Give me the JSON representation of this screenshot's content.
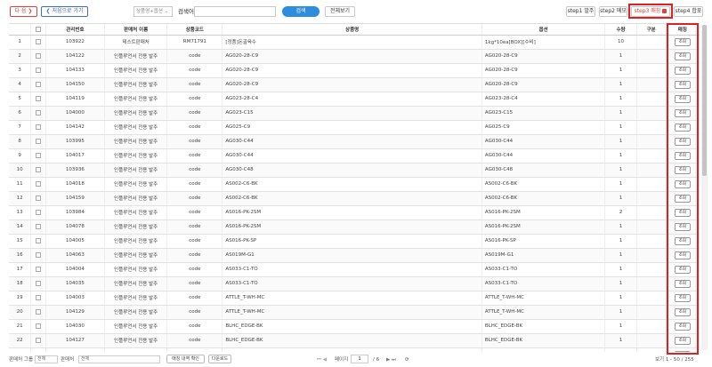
{
  "toolbar": {
    "next_label": "다 음",
    "first_label": "처음으로 가기",
    "filter_select": "상품명+옵션",
    "search_label": "검색어",
    "search_value": "",
    "search_button": "검색",
    "view_all_button": "전체보기",
    "step1": "step1 발주",
    "step2": "step2 메모",
    "step3": "step3 매칭",
    "step4": "step4 합포"
  },
  "columns": [
    "",
    "",
    "관리번호",
    "판매처 이름",
    "상품코드",
    "상품명",
    "옵션",
    "수량",
    "구분",
    "매칭"
  ],
  "lookup_label": "조회",
  "rows": [
    {
      "no": "1",
      "id": "103922",
      "seller": "테스트판매처",
      "code": "RM71791",
      "name": "[정품]돈골육수",
      "option": "1kg*10ea[BOX][수비]",
      "qty": "10"
    },
    {
      "no": "2",
      "id": "104122",
      "seller": "인플루언서 전용 발주",
      "code": "code",
      "name": "AG020-28-C9",
      "option": "AG020-28-C9",
      "qty": "1"
    },
    {
      "no": "3",
      "id": "104133",
      "seller": "인플루언서 전용 발주",
      "code": "code",
      "name": "AG020-28-C9",
      "option": "AG020-28-C9",
      "qty": "1"
    },
    {
      "no": "4",
      "id": "104150",
      "seller": "인플루언서 전용 발주",
      "code": "code",
      "name": "AG020-28-C9",
      "option": "AG020-28-C9",
      "qty": "1"
    },
    {
      "no": "5",
      "id": "104119",
      "seller": "인플루언서 전용 발주",
      "code": "code",
      "name": "AG023-28-C4",
      "option": "AG023-28-C4",
      "qty": "1"
    },
    {
      "no": "6",
      "id": "104000",
      "seller": "인플루언서 전용 발주",
      "code": "code",
      "name": "AG023-C15",
      "option": "AG023-C15",
      "qty": "1"
    },
    {
      "no": "7",
      "id": "104142",
      "seller": "인플루언서 전용 발주",
      "code": "code",
      "name": "AG025-C9",
      "option": "AG025-C9",
      "qty": "1"
    },
    {
      "no": "8",
      "id": "103995",
      "seller": "인플루언서 전용 발주",
      "code": "code",
      "name": "AG030-C44",
      "option": "AG030-C44",
      "qty": "1"
    },
    {
      "no": "9",
      "id": "104017",
      "seller": "인플루언서 전용 발주",
      "code": "code",
      "name": "AG030-C44",
      "option": "AG030-C44",
      "qty": "1"
    },
    {
      "no": "10",
      "id": "103936",
      "seller": "인플루언서 전용 발주",
      "code": "code",
      "name": "AG030-C48",
      "option": "AG030-C48",
      "qty": "1"
    },
    {
      "no": "11",
      "id": "104018",
      "seller": "인플루언서 전용 발주",
      "code": "code",
      "name": "AS002-C6-BK",
      "option": "AS002-C6-BK",
      "qty": "1"
    },
    {
      "no": "12",
      "id": "104159",
      "seller": "인플루언서 전용 발주",
      "code": "code",
      "name": "AS002-C6-BK",
      "option": "AS002-C6-BK",
      "qty": "1"
    },
    {
      "no": "13",
      "id": "103984",
      "seller": "인플루언서 전용 발주",
      "code": "code",
      "name": "AS016-PK-2SM",
      "option": "AS016-PK-2SM",
      "qty": "2"
    },
    {
      "no": "14",
      "id": "104078",
      "seller": "인플루언서 전용 발주",
      "code": "code",
      "name": "AS016-PK-2SM",
      "option": "AS016-PK-2SM",
      "qty": "1"
    },
    {
      "no": "15",
      "id": "104005",
      "seller": "인플루언서 전용 발주",
      "code": "code",
      "name": "AS016-PK-SP",
      "option": "AS016-PK-SP",
      "qty": "1"
    },
    {
      "no": "16",
      "id": "104063",
      "seller": "인플루언서 전용 발주",
      "code": "code",
      "name": "AS019M-G1",
      "option": "AS019M-G1",
      "qty": "1"
    },
    {
      "no": "17",
      "id": "104004",
      "seller": "인플루언서 전용 발주",
      "code": "code",
      "name": "AS033-C1-TO",
      "option": "AS033-C1-TO",
      "qty": "1"
    },
    {
      "no": "18",
      "id": "104035",
      "seller": "인플루언서 전용 발주",
      "code": "code",
      "name": "AS033-C1-TO",
      "option": "AS033-C1-TO",
      "qty": "1"
    },
    {
      "no": "19",
      "id": "104003",
      "seller": "인플루언서 전용 발주",
      "code": "code",
      "name": "ATTLE_T-WH-MC",
      "option": "ATTLE_T-WH-MC",
      "qty": "1"
    },
    {
      "no": "20",
      "id": "104129",
      "seller": "인플루언서 전용 발주",
      "code": "code",
      "name": "ATTLE_T-WH-MC",
      "option": "ATTLE_T-WH-MC",
      "qty": "1"
    },
    {
      "no": "21",
      "id": "104030",
      "seller": "인플루언서 전용 발주",
      "code": "code",
      "name": "BLHC_EDGE-BK",
      "option": "BLHC_EDGE-BK",
      "qty": "1"
    },
    {
      "no": "22",
      "id": "104127",
      "seller": "인플루언서 전용 발주",
      "code": "code",
      "name": "BLHC_EDGE-BK",
      "option": "BLHC_EDGE-BK",
      "qty": "1"
    },
    {
      "no": "23",
      "id": "104106",
      "seller": "인플루언서 전용 발주",
      "code": "code",
      "name": "BLHC_EDGE-GL",
      "option": "BLHC_EDGE-GL",
      "qty": "1"
    }
  ],
  "footer": {
    "seller_group_label": "판매처 그룹",
    "seller_group_value": "전체",
    "seller_label": "판매처",
    "seller_value": "전체",
    "match_history_button": "매칭 내역 확인",
    "download_button": "다운로드",
    "pager_first_prev": "⏮ ◀",
    "page_label": "페이지",
    "page_value": "1",
    "page_total": "/ 6",
    "pager_next_last": "▶ ⏭",
    "refresh_icon": "⟳",
    "view_count": "보기 1 - 50 / 255"
  }
}
